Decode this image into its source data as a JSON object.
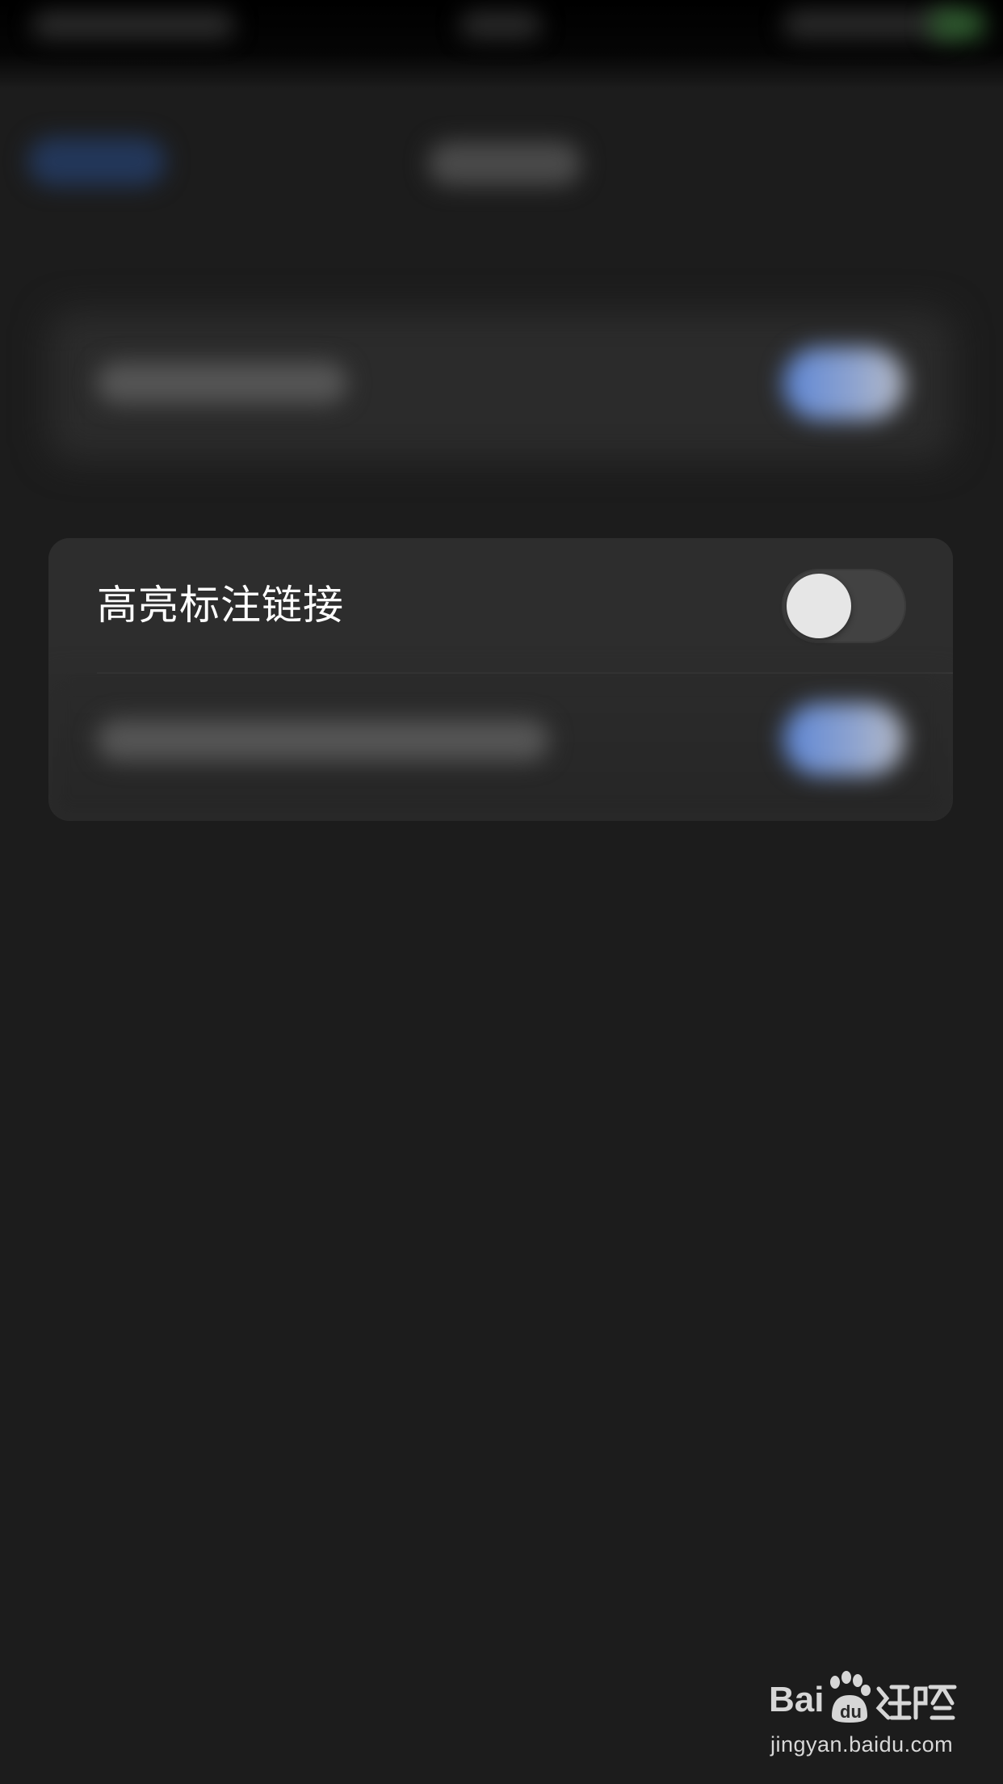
{
  "settings": {
    "highlight_links": {
      "label": "高亮标注链接",
      "enabled": false
    }
  },
  "colors": {
    "background": "#1c1c1c",
    "card": "#2c2c2c",
    "toggle_off_track": "#424242",
    "toggle_knob": "#e6e6e6",
    "toggle_on": "#5d86d6",
    "text": "#ffffff"
  },
  "watermark": {
    "logo_name": "baidu-jingyan-logo",
    "url_text": "jingyan.baidu.com"
  }
}
